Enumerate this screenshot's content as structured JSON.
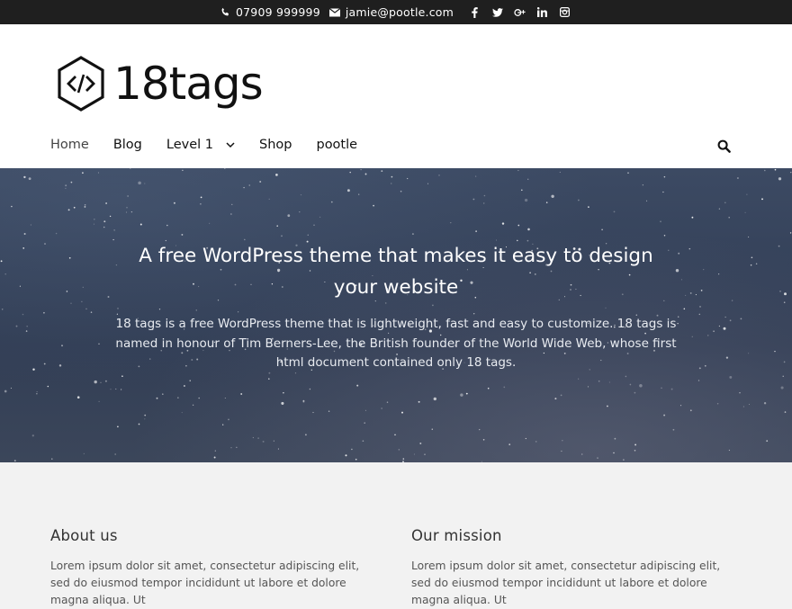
{
  "topbar": {
    "phone": "07909 999999",
    "email": "jamie@pootle.com",
    "social_icons": [
      "facebook-icon",
      "twitter-icon",
      "google-plus-icon",
      "linkedin-icon",
      "instagram-icon"
    ]
  },
  "header": {
    "logo_text": "18tags",
    "logo_icon": "code-hexagon-icon"
  },
  "nav": {
    "items": [
      {
        "label": "Home"
      },
      {
        "label": "Blog"
      },
      {
        "label": "Level 1"
      },
      {
        "label": "Shop"
      },
      {
        "label": "pootle"
      }
    ],
    "search_icon": "search-icon"
  },
  "hero": {
    "title": "A free WordPress theme that makes it easy to design your website",
    "text": "18 tags is a free WordPress theme that is lightweight, fast and easy to customize. 18 tags is named in honour of Tim Berners-Lee, the British founder of the World Wide Web, whose first html document contained only 18 tags."
  },
  "sections": [
    {
      "heading": "About us",
      "text": "Lorem ipsum dolor sit amet, consectetur adipiscing elit, sed do eiusmod tempor incididunt ut labore et dolore magna aliqua. Ut"
    },
    {
      "heading": "Our mission",
      "text": "Lorem ipsum dolor sit amet, consectetur adipiscing elit, sed do eiusmod tempor incididunt ut labore et dolore magna aliqua. Ut"
    }
  ],
  "colors": {
    "topbar_bg": "#1f1f1f",
    "hero_bg": "#35425a",
    "content_bg": "#f2f2f2"
  }
}
